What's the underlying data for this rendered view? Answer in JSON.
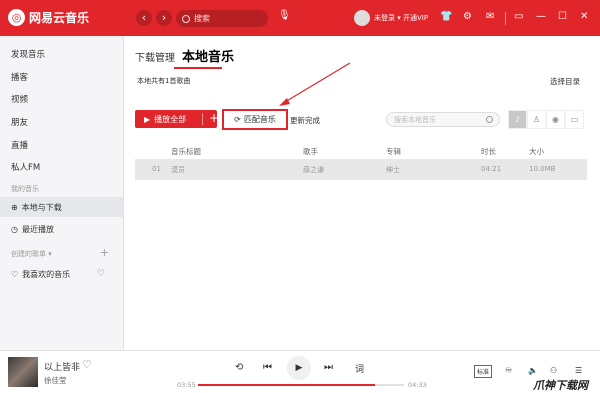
{
  "app": {
    "name": "网易云音乐",
    "logo_glyph": "◎"
  },
  "topbar": {
    "back_icon": "‹",
    "forward_icon": "›",
    "search_placeholder": "搜索",
    "user_label": "未登录 ▾ 开通VIP"
  },
  "sidebar": {
    "items": [
      {
        "label": "发现音乐"
      },
      {
        "label": "播客"
      },
      {
        "label": "视频"
      },
      {
        "label": "朋友"
      },
      {
        "label": "直播"
      },
      {
        "label": "私人FM"
      }
    ],
    "my_music_title": "我的音乐",
    "local_download": "本地与下载",
    "recent_play": "最近播放",
    "created_playlists_title": "创建的歌单 ▾",
    "liked_music": "我喜欢的音乐"
  },
  "main": {
    "tabs": [
      {
        "label": "下载管理"
      },
      {
        "label": "本地音乐"
      }
    ],
    "local_count": "本地共有1首歌曲",
    "select_dir": "选择目录",
    "play_all": "播放全部",
    "match_music": "匹配音乐",
    "refresh": "更新完成",
    "search_placeholder": "搜索本地音乐",
    "table": {
      "headers": [
        "音乐标题",
        "歌手",
        "专辑",
        "时长",
        "大小"
      ],
      "rows": [
        {
          "index": "01",
          "title": "漠员",
          "artist": "薛之谦",
          "album": "绅士",
          "duration": "04:21",
          "size": "10.0MB"
        }
      ]
    }
  },
  "player": {
    "song_title": "以上皆非",
    "artist": "徐佳莹",
    "current_time": "03:55",
    "total_time": "04:33",
    "progress": 0.86,
    "lyrics_btn": "词",
    "quality": "标准"
  },
  "watermark": "爪神下载网",
  "colors": {
    "accent": "#e0262b"
  }
}
